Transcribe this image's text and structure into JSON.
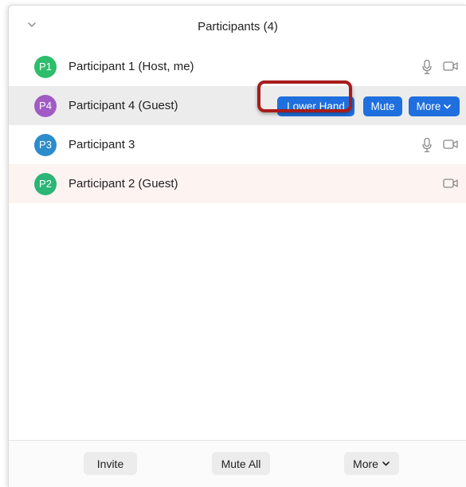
{
  "header": {
    "title": "Participants (4)"
  },
  "participants": [
    {
      "initials": "P1",
      "name": "Participant 1 (Host, me)",
      "avatar_color": "#2ebd6b",
      "show_mic": true,
      "show_cam": true
    },
    {
      "initials": "P4",
      "name": "Participant 4 (Guest)",
      "avatar_color": "#a05cc4",
      "actions": [
        "Lower Hand",
        "Mute",
        "More"
      ]
    },
    {
      "initials": "P3",
      "name": "Participant 3",
      "avatar_color": "#2d8ccc",
      "show_mic": true,
      "show_cam": true
    },
    {
      "initials": "P2",
      "name": "Participant 2 (Guest)",
      "avatar_color": "#2bb576",
      "show_mic": false,
      "show_cam": true
    }
  ],
  "footer": {
    "invite": "Invite",
    "mute_all": "Mute All",
    "more": "More"
  },
  "colors": {
    "accent": "#1f6fde",
    "highlight_border": "#a81b1b"
  }
}
